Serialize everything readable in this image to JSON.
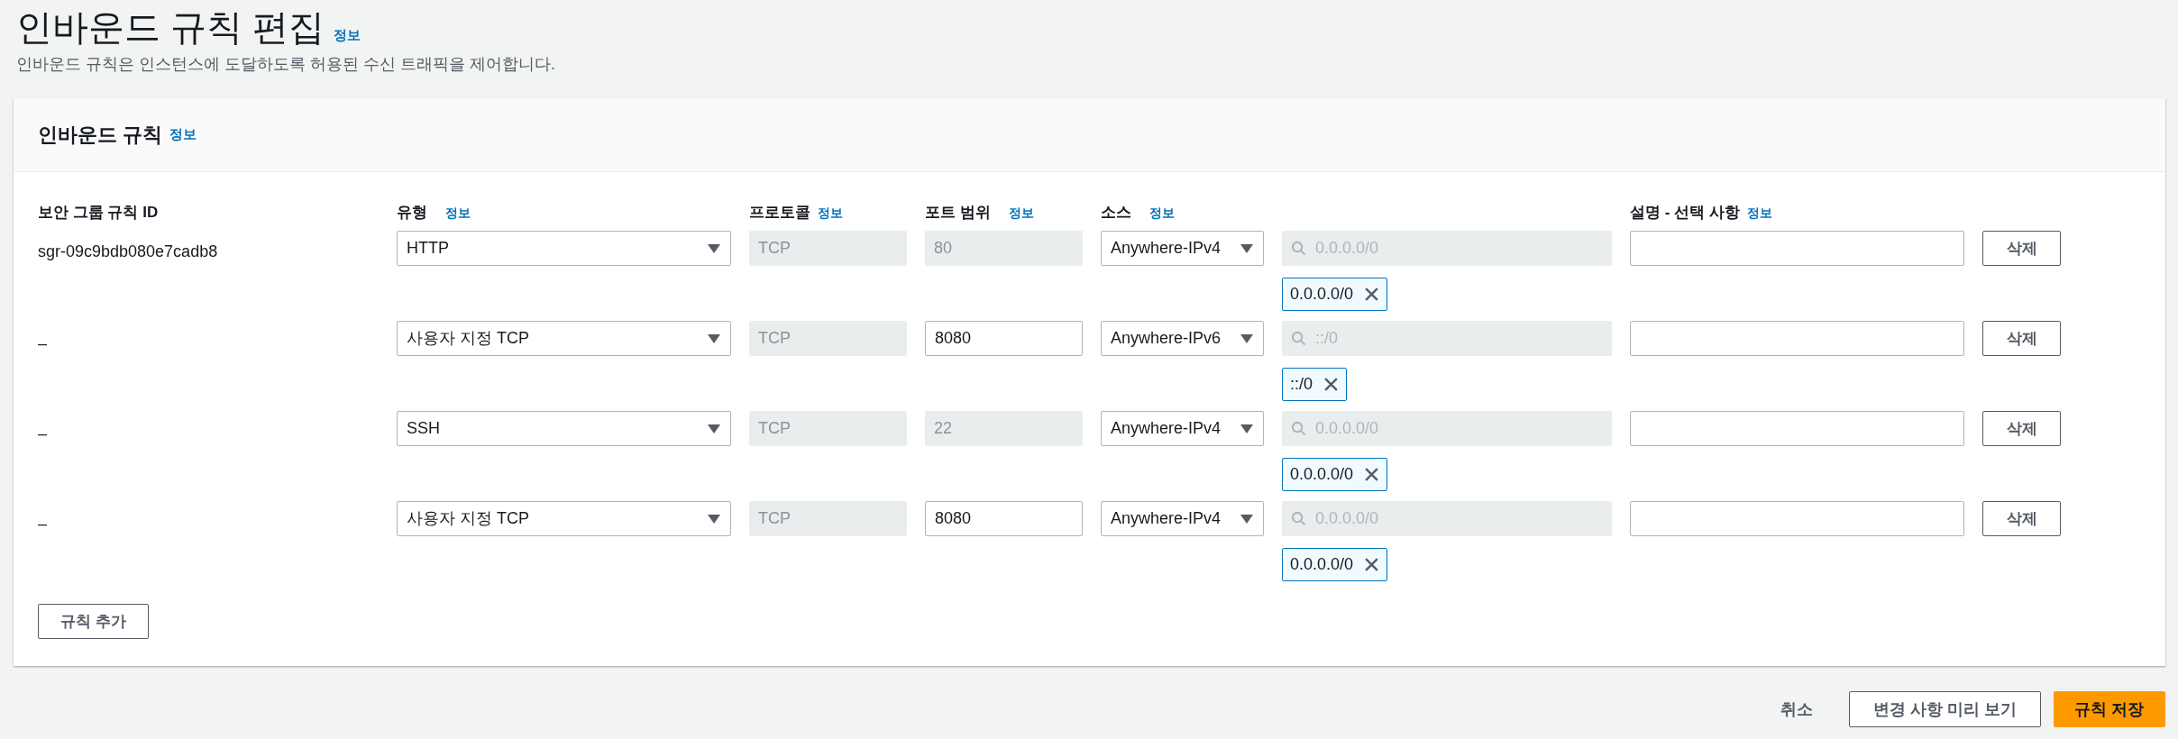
{
  "page": {
    "title": "인바운드 규칙 편집",
    "info_link": "정보",
    "description": "인바운드 규칙은 인스턴스에 도달하도록 허용된 수신 트래픽을 제어합니다."
  },
  "panel": {
    "title": "인바운드 규칙",
    "info_link": "정보"
  },
  "table": {
    "columns": [
      {
        "label": "보안 그룹 규칙 ID"
      },
      {
        "label": "유형",
        "info_link": "정보"
      },
      {
        "label": "프로토콜",
        "info_link": "정보"
      },
      {
        "label": "포트 범위",
        "info_link": "정보"
      },
      {
        "label": "소스",
        "info_link": "정보"
      },
      {
        "label": "설명 - 선택 사항",
        "info_link": "정보"
      }
    ],
    "rows": [
      {
        "rule_id": "sgr-09c9bdb080e7cadb8",
        "type": "HTTP",
        "protocol": "TCP",
        "port_range": "80",
        "port_disabled": true,
        "source": "Anywhere-IPv4",
        "cidr_placeholder": "0.0.0.0/0",
        "cidr_tokens": [
          "0.0.0.0/0"
        ],
        "delete_button": "삭제"
      },
      {
        "rule_id": "–",
        "type": "사용자 지정 TCP",
        "protocol": "TCP",
        "port_range": "8080",
        "port_disabled": false,
        "source": "Anywhere-IPv6",
        "cidr_placeholder": "::/0",
        "cidr_tokens": [
          "::/0"
        ],
        "delete_button": "삭제"
      },
      {
        "rule_id": "–",
        "type": "SSH",
        "protocol": "TCP",
        "port_range": "22",
        "port_disabled": true,
        "source": "Anywhere-IPv4",
        "cidr_placeholder": "0.0.0.0/0",
        "cidr_tokens": [
          "0.0.0.0/0"
        ],
        "delete_button": "삭제"
      },
      {
        "rule_id": "–",
        "type": "사용자 지정 TCP",
        "protocol": "TCP",
        "port_range": "8080",
        "port_disabled": false,
        "source": "Anywhere-IPv4",
        "cidr_placeholder": "0.0.0.0/0",
        "cidr_tokens": [
          "0.0.0.0/0"
        ],
        "delete_button": "삭제"
      }
    ]
  },
  "add_rule_button": "규칙 추가",
  "footer": {
    "cancel": "취소",
    "preview": "변경 사항 미리 보기",
    "save": "규칙 저장"
  }
}
